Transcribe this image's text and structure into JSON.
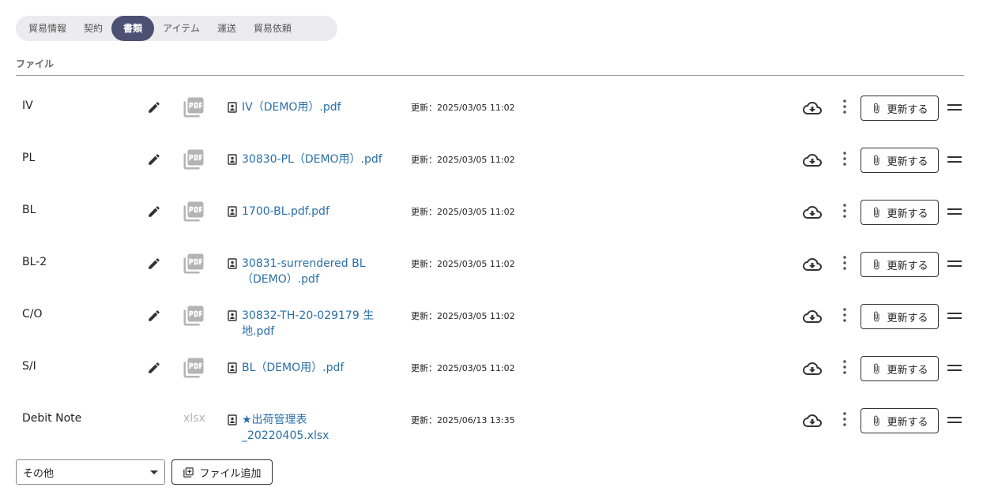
{
  "tabs": [
    {
      "label": "貿易情報",
      "active": false
    },
    {
      "label": "契約",
      "active": false
    },
    {
      "label": "書類",
      "active": true
    },
    {
      "label": "アイテム",
      "active": false
    },
    {
      "label": "運送",
      "active": false
    },
    {
      "label": "貿易依頼",
      "active": false
    }
  ],
  "section": {
    "title": "ファイル"
  },
  "documents": [
    {
      "type": "IV",
      "file_kind": "pdf",
      "file_name": "IV（DEMO用）.pdf",
      "updated": "更新：2025/03/05 11:02",
      "update_label": "更新する"
    },
    {
      "type": "PL",
      "file_kind": "pdf",
      "file_name": "30830-PL（DEMO用）.pdf",
      "updated": "更新：2025/03/05 11:02",
      "update_label": "更新する"
    },
    {
      "type": "BL",
      "file_kind": "pdf",
      "file_name": "1700-BL.pdf.pdf",
      "updated": "更新：2025/03/05 11:02",
      "update_label": "更新する"
    },
    {
      "type": "BL-2",
      "file_kind": "pdf",
      "file_name": "30831-surrendered BL（DEMO）.pdf",
      "updated": "更新：2025/03/05 11:02",
      "update_label": "更新する"
    },
    {
      "type": "C/O",
      "file_kind": "pdf",
      "file_name": "30832-TH-20-029179 生地.pdf",
      "updated": "更新：2025/03/05 11:02",
      "update_label": "更新する"
    },
    {
      "type": "S/I",
      "file_kind": "pdf",
      "file_name": "BL（DEMO用）.pdf",
      "updated": "更新：2025/03/05 11:02",
      "update_label": "更新する"
    },
    {
      "type": "Debit Note",
      "file_kind": "xlsx",
      "file_name": "★出荷管理表_20220405.xlsx",
      "updated": "更新：2025/06/13 13:35",
      "update_label": "更新する"
    }
  ],
  "footer": {
    "select_value": "その他",
    "add_file_label": "ファイル追加"
  },
  "colors": {
    "tab_active_bg": "#4c5072",
    "tab_bar_bg": "#ececee",
    "link": "#2a6fa8"
  }
}
